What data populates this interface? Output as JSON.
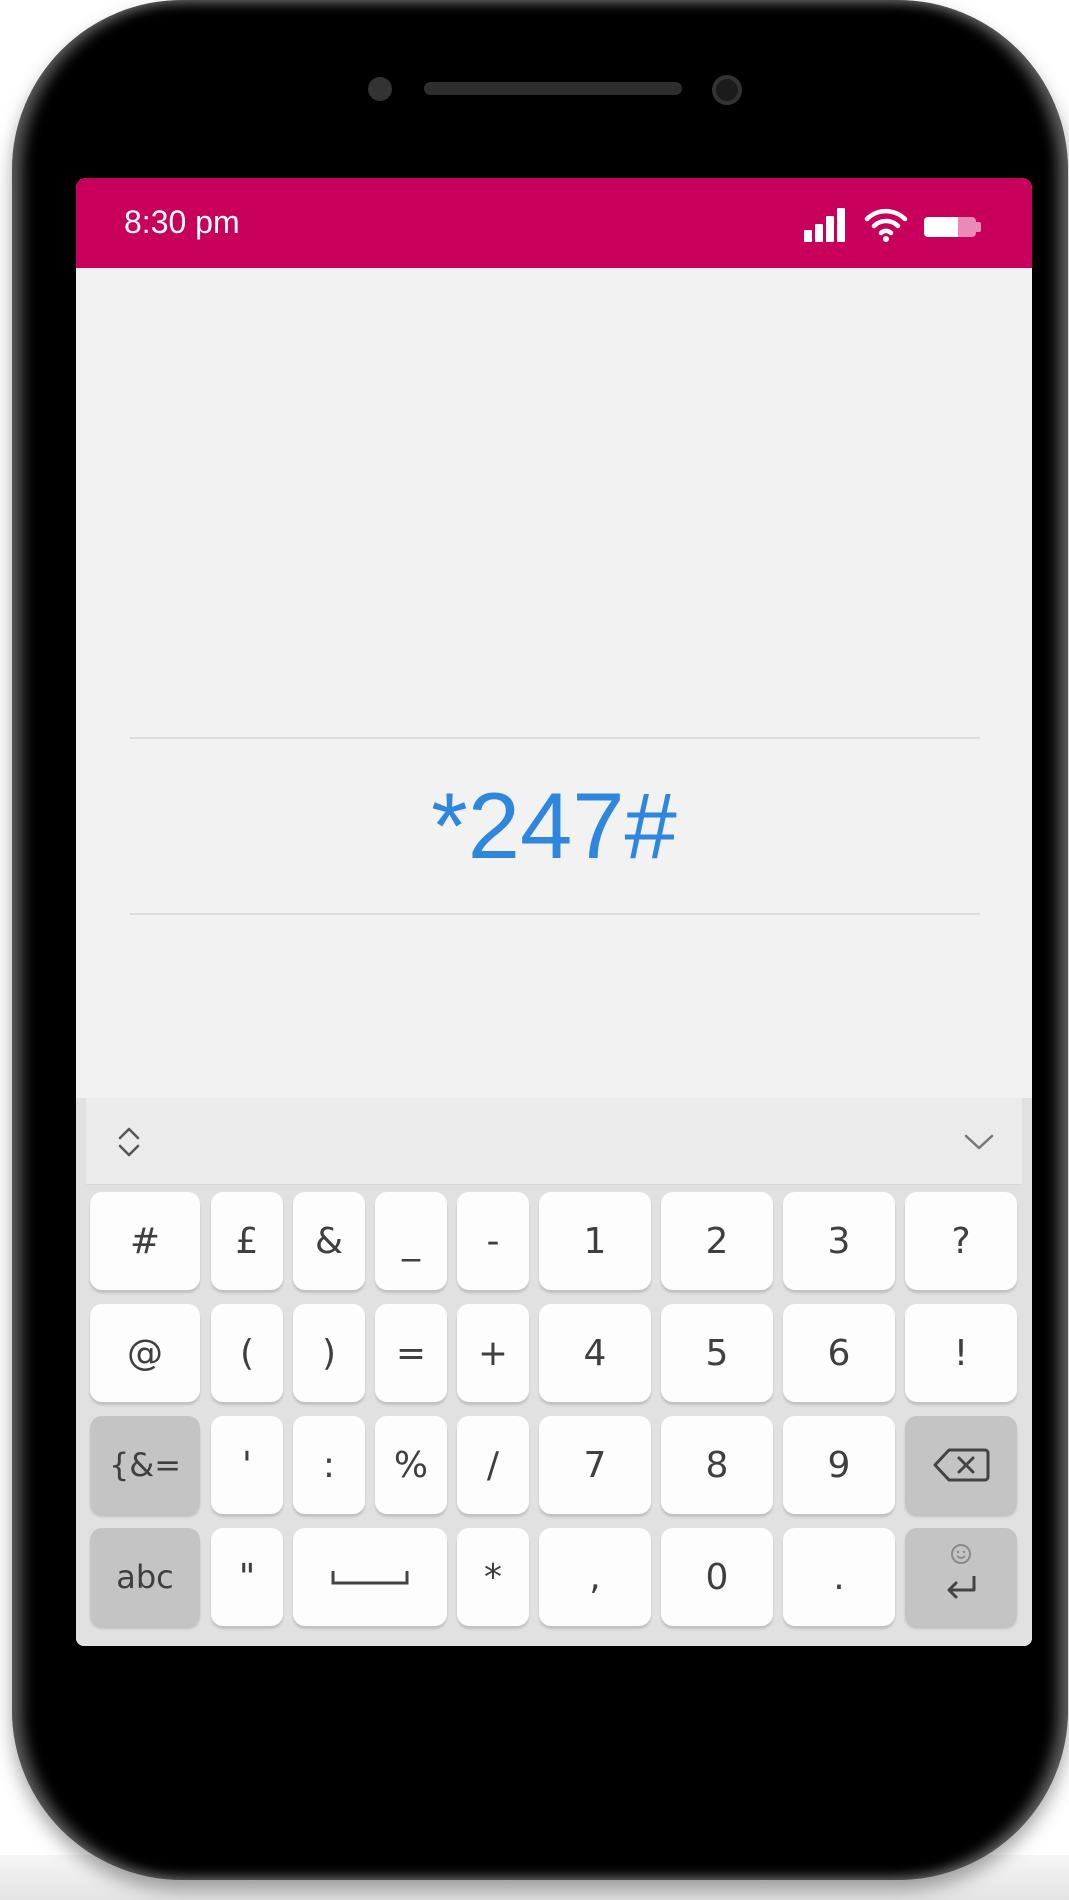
{
  "status_bar": {
    "time": "8:30 pm",
    "background_color": "#c8005c",
    "icons": [
      "signal-icon",
      "wifi-icon",
      "battery-icon"
    ],
    "battery_level": 0.65
  },
  "dialer": {
    "code": "*247#",
    "code_color": "#2f86de"
  },
  "keyboard": {
    "toolbar_icons": [
      "expand-icon",
      "collapse-icon"
    ],
    "keys": {
      "hash": "#",
      "pound": "£",
      "ampersand": "&",
      "underscore": "_",
      "minus": "-",
      "d1": "1",
      "d2": "2",
      "d3": "3",
      "question": "?",
      "at": "@",
      "lparen": "(",
      "rparen": ")",
      "equals": "=",
      "plus": "+",
      "d4": "4",
      "d5": "5",
      "d6": "6",
      "exclaim": "!",
      "symbols": "{&=",
      "apostrophe": "'",
      "colon": ":",
      "percent": "%",
      "slash": "/",
      "d7": "7",
      "d8": "8",
      "d9": "9",
      "abc": "abc",
      "quote": "\"",
      "asterisk": "*",
      "comma": ",",
      "d0": "0",
      "period": "."
    }
  }
}
